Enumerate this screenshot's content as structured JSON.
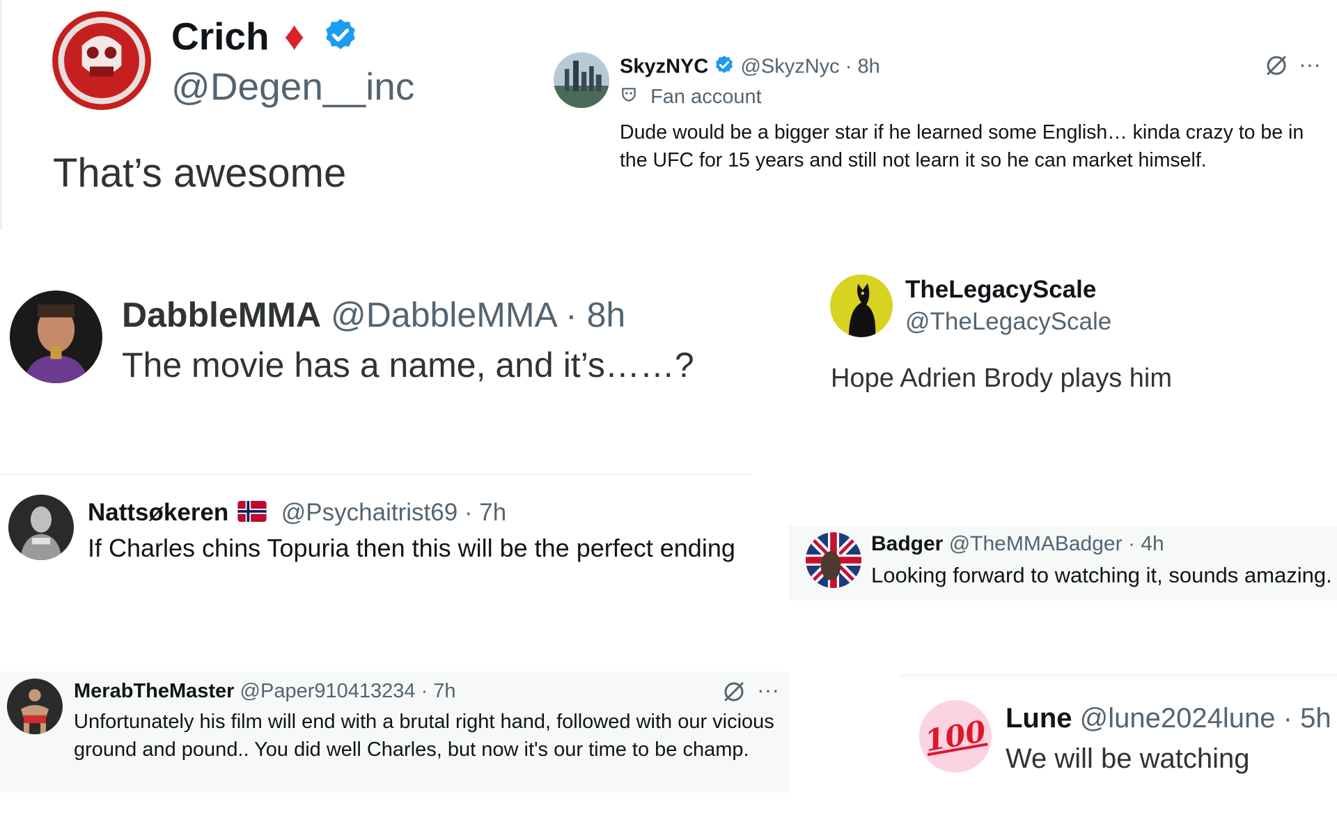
{
  "tweets": {
    "crich": {
      "name": "Crich",
      "name_emoji": "♦",
      "handle": "@Degen__inc",
      "text": "That’s awesome"
    },
    "skyz": {
      "name": "SkyzNYC",
      "handle": "@SkyzNyc",
      "time": "· 8h",
      "label": "Fan account",
      "text": "Dude would be a bigger star if he learned some English… kinda crazy to be in the UFC for 15 years and still not learn it so he can market himself.",
      "more": "···"
    },
    "dabble": {
      "name": "DabbleMMA",
      "handle": "@DabbleMMA",
      "time": "· 8h",
      "text": "The movie has a name, and it’s……?"
    },
    "legacy": {
      "name": "TheLegacyScale",
      "handle": "@TheLegacyScale",
      "text": "Hope Adrien Brody plays him"
    },
    "natt": {
      "name": "Nattsøkeren",
      "handle": "@Psychaitrist69",
      "time": "· 7h",
      "text": "If Charles chins Topuria then this will be the perfect ending"
    },
    "badger": {
      "name": "Badger",
      "handle": "@TheMMABadger",
      "time": "· 4h",
      "text": "Looking forward to watching it, sounds amazing."
    },
    "merab": {
      "name": "MerabTheMaster",
      "handle": "@Paper910413234",
      "time": "· 7h",
      "text": "Unfortunately his film will end with a brutal right hand, followed with our vicious ground and pound.. You did well Charles, but now it's our time to be champ.",
      "more": "···"
    },
    "lune": {
      "name": "Lune",
      "handle": "@lune2024lune",
      "time": "· 5h",
      "avatar_text": "100",
      "text": "We will be watching"
    }
  },
  "colors": {
    "verified": "#1d9bf0",
    "secondary_text": "#536471",
    "primary_text": "#0f1419",
    "highlight_bg": "#f7f9f9"
  },
  "icons": [
    "verified-badge-icon",
    "diamond-icon",
    "grok-icon",
    "more-icon",
    "fan-account-icon",
    "norway-flag-icon"
  ]
}
